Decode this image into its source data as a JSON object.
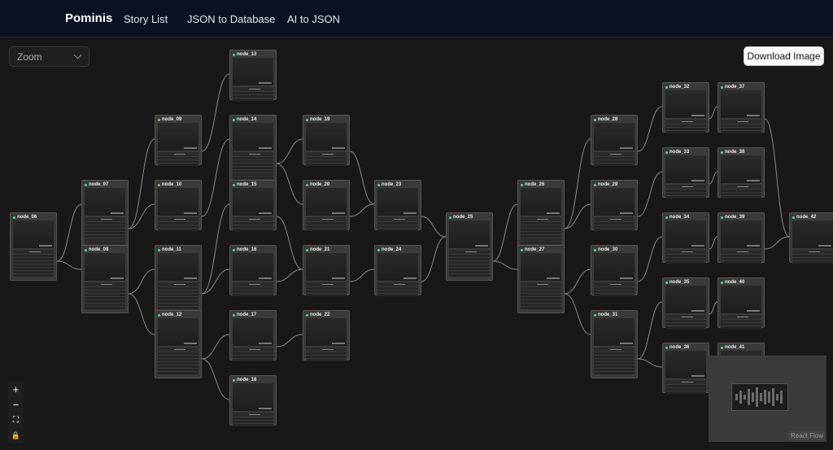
{
  "app": {
    "brand": "Pominis"
  },
  "nav": [
    {
      "label": "Story List"
    },
    {
      "label": "JSON to Database"
    },
    {
      "label": "AI to JSON"
    }
  ],
  "canvas": {
    "zoom_label": "Zoom",
    "download_label": "Download Image",
    "attribution": "React Flow",
    "controls": [
      "+",
      "−",
      "⛶",
      "🔒"
    ]
  },
  "nodes": [
    "node_06",
    "node_07",
    "node_08",
    "node_09",
    "node_10",
    "node_11",
    "node_12",
    "node_13",
    "node_14",
    "node_15",
    "node_16",
    "node_17",
    "node_18",
    "node_19",
    "node_20",
    "node_21",
    "node_22",
    "node_23",
    "node_24",
    "node_25",
    "node_26",
    "node_27",
    "node_28",
    "node_29",
    "node_30",
    "node_31",
    "node_32",
    "node_33",
    "node_34",
    "node_35",
    "node_36",
    "node_37",
    "node_38",
    "node_39",
    "node_40",
    "node_41",
    "node_42"
  ]
}
